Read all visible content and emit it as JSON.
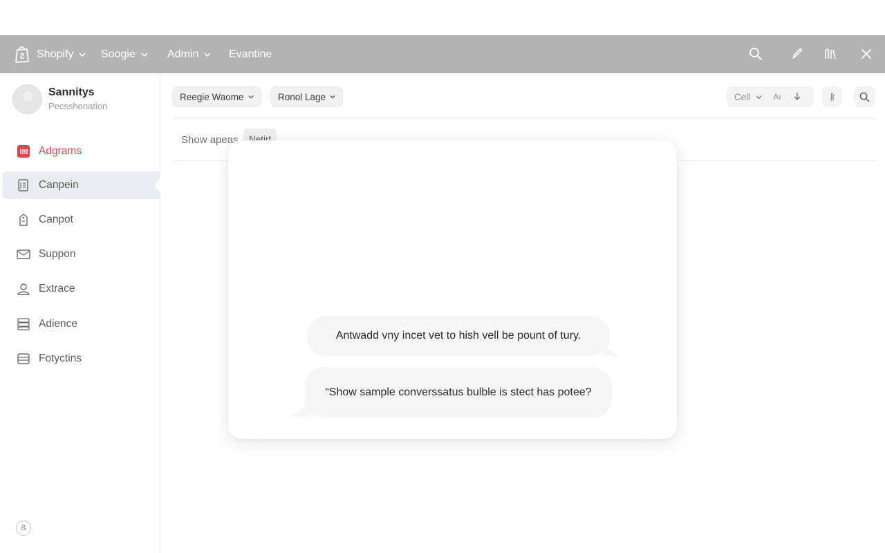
{
  "nav": {
    "items": [
      {
        "label": "Shopify"
      },
      {
        "label": "Soogie"
      },
      {
        "label": "Admin"
      },
      {
        "label": "Evantine"
      }
    ],
    "icons": [
      "search-icon",
      "edit-icon",
      "library-icon",
      "close-icon"
    ]
  },
  "user": {
    "name": "Sannitys",
    "role": "Pecsshonation"
  },
  "sidebar": {
    "items": [
      {
        "label": "Adgrams",
        "icon": "grid-icon"
      },
      {
        "label": "Canpein",
        "icon": "document-icon"
      },
      {
        "label": "Canpot",
        "icon": "tag-icon"
      },
      {
        "label": "Suppon",
        "icon": "mail-icon"
      },
      {
        "label": "Extrace",
        "icon": "user-icon"
      },
      {
        "label": "Adience",
        "icon": "database-icon"
      },
      {
        "label": "Fotyctins",
        "icon": "card-icon"
      }
    ],
    "footer": "ß"
  },
  "toolbar": {
    "filter1": "Reegie Waome",
    "filter2": "Ronol Lage",
    "group_label": "Cell",
    "group_icon_text": "Aı"
  },
  "content": {
    "subhead": "Show apeas",
    "chip": "Netirt"
  },
  "modal": {
    "bubble1": "Antwadd vny incet vet to hish vell be pount of tury.",
    "bubble2": "“Show sample converssatus bulble is stect has potee?"
  },
  "colors": {
    "navbar": "#b3b3b3",
    "accent_red": "#e0444f",
    "selected_bg": "#e8eced"
  }
}
